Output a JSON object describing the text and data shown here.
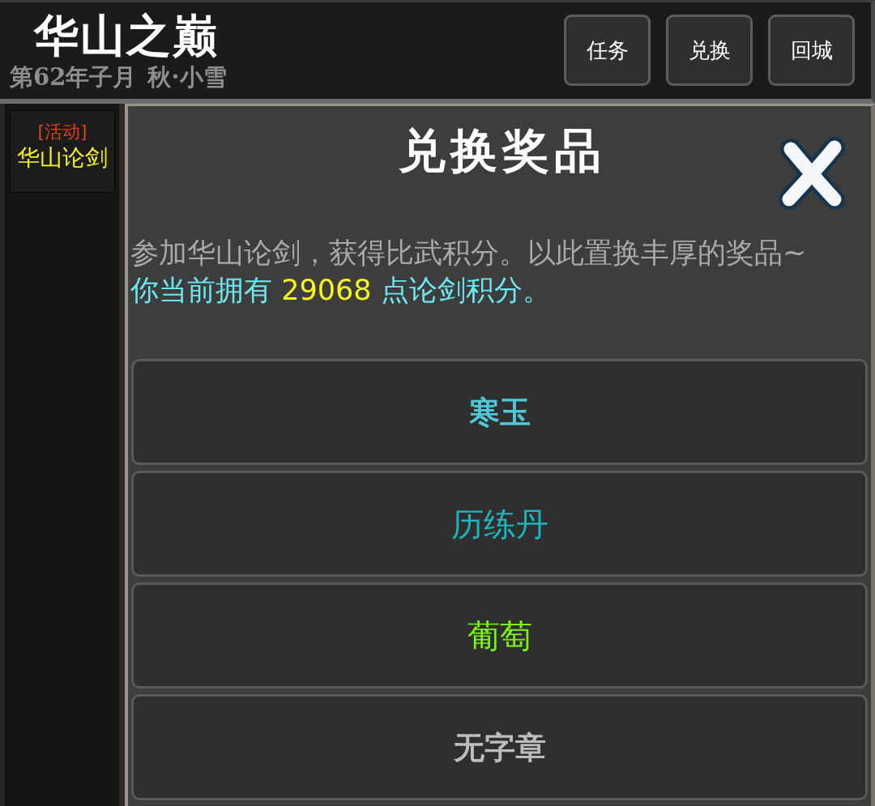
{
  "header": {
    "title": "华山之巅",
    "date": "第62年子月 秋·小雪"
  },
  "header_buttons": [
    {
      "label": "任务"
    },
    {
      "label": "兑换"
    },
    {
      "label": "回城"
    }
  ],
  "sidebar": {
    "items": [
      {
        "tag": "[活动]",
        "label": "华山论剑"
      }
    ]
  },
  "panel": {
    "title": "兑换奖品",
    "description": "参加华山论剑，获得比武积分。以此置换丰厚的奖品~",
    "balance": {
      "prefix": "你当前拥有 ",
      "points": "29068",
      "suffix": " 点论剑积分。"
    },
    "rewards": [
      {
        "label": "寒玉",
        "kind": "calligraphy",
        "color": "#4ec8d8"
      },
      {
        "label": "历练丹",
        "kind": "plain",
        "color": "#1eb4bc"
      },
      {
        "label": "葡萄",
        "kind": "plain",
        "color": "#7cf01c"
      },
      {
        "label": "无字章",
        "kind": "calligraphy",
        "color": "#bdbdbd"
      }
    ]
  }
}
